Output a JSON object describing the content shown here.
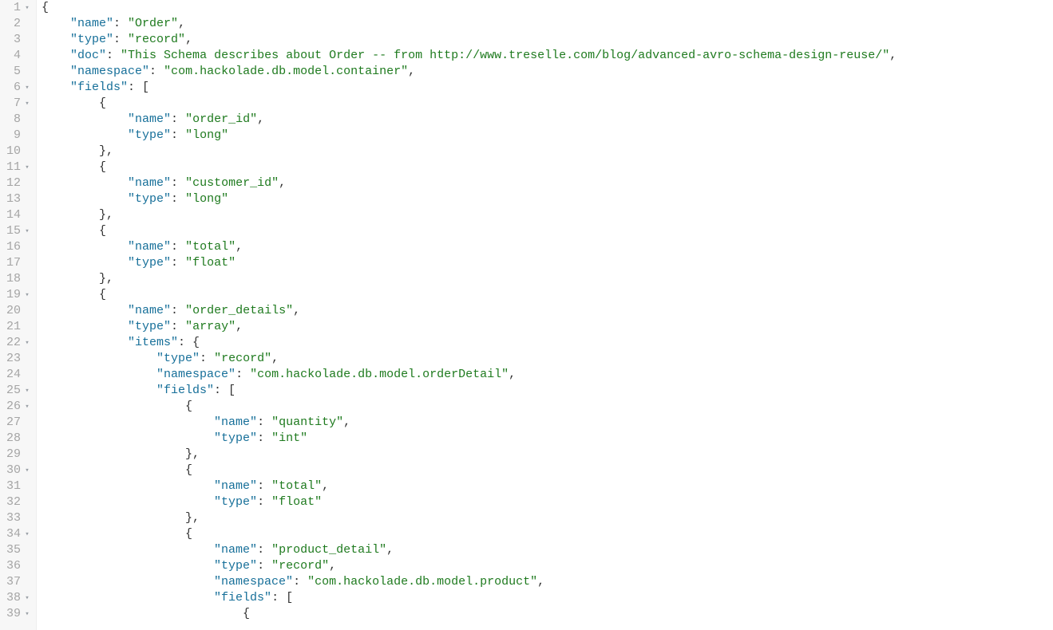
{
  "editor": {
    "line_count": 39,
    "fold_lines": [
      1,
      6,
      7,
      11,
      15,
      19,
      22,
      25,
      26,
      30,
      34,
      38,
      39
    ]
  },
  "code_lines": [
    {
      "indent": 0,
      "tokens": [
        {
          "t": "punct",
          "v": "{"
        }
      ]
    },
    {
      "indent": 4,
      "tokens": [
        {
          "t": "key",
          "v": "\"name\""
        },
        {
          "t": "punct",
          "v": ": "
        },
        {
          "t": "str",
          "v": "\"Order\""
        },
        {
          "t": "punct",
          "v": ","
        }
      ]
    },
    {
      "indent": 4,
      "tokens": [
        {
          "t": "key",
          "v": "\"type\""
        },
        {
          "t": "punct",
          "v": ": "
        },
        {
          "t": "str",
          "v": "\"record\""
        },
        {
          "t": "punct",
          "v": ","
        }
      ]
    },
    {
      "indent": 4,
      "tokens": [
        {
          "t": "key",
          "v": "\"doc\""
        },
        {
          "t": "punct",
          "v": ": "
        },
        {
          "t": "str",
          "v": "\"This Schema describes about Order -- from http://www.treselle.com/blog/advanced-avro-schema-design-reuse/\""
        },
        {
          "t": "punct",
          "v": ","
        }
      ]
    },
    {
      "indent": 4,
      "tokens": [
        {
          "t": "key",
          "v": "\"namespace\""
        },
        {
          "t": "punct",
          "v": ": "
        },
        {
          "t": "str",
          "v": "\"com.hackolade.db.model.container\""
        },
        {
          "t": "punct",
          "v": ","
        }
      ]
    },
    {
      "indent": 4,
      "tokens": [
        {
          "t": "key",
          "v": "\"fields\""
        },
        {
          "t": "punct",
          "v": ": ["
        }
      ]
    },
    {
      "indent": 8,
      "tokens": [
        {
          "t": "punct",
          "v": "{"
        }
      ]
    },
    {
      "indent": 12,
      "tokens": [
        {
          "t": "key",
          "v": "\"name\""
        },
        {
          "t": "punct",
          "v": ": "
        },
        {
          "t": "str",
          "v": "\"order_id\""
        },
        {
          "t": "punct",
          "v": ","
        }
      ]
    },
    {
      "indent": 12,
      "tokens": [
        {
          "t": "key",
          "v": "\"type\""
        },
        {
          "t": "punct",
          "v": ": "
        },
        {
          "t": "str",
          "v": "\"long\""
        }
      ]
    },
    {
      "indent": 8,
      "tokens": [
        {
          "t": "punct",
          "v": "},"
        }
      ]
    },
    {
      "indent": 8,
      "tokens": [
        {
          "t": "punct",
          "v": "{"
        }
      ]
    },
    {
      "indent": 12,
      "tokens": [
        {
          "t": "key",
          "v": "\"name\""
        },
        {
          "t": "punct",
          "v": ": "
        },
        {
          "t": "str",
          "v": "\"customer_id\""
        },
        {
          "t": "punct",
          "v": ","
        }
      ]
    },
    {
      "indent": 12,
      "tokens": [
        {
          "t": "key",
          "v": "\"type\""
        },
        {
          "t": "punct",
          "v": ": "
        },
        {
          "t": "str",
          "v": "\"long\""
        }
      ]
    },
    {
      "indent": 8,
      "tokens": [
        {
          "t": "punct",
          "v": "},"
        }
      ]
    },
    {
      "indent": 8,
      "tokens": [
        {
          "t": "punct",
          "v": "{"
        }
      ]
    },
    {
      "indent": 12,
      "tokens": [
        {
          "t": "key",
          "v": "\"name\""
        },
        {
          "t": "punct",
          "v": ": "
        },
        {
          "t": "str",
          "v": "\"total\""
        },
        {
          "t": "punct",
          "v": ","
        }
      ]
    },
    {
      "indent": 12,
      "tokens": [
        {
          "t": "key",
          "v": "\"type\""
        },
        {
          "t": "punct",
          "v": ": "
        },
        {
          "t": "str",
          "v": "\"float\""
        }
      ]
    },
    {
      "indent": 8,
      "tokens": [
        {
          "t": "punct",
          "v": "},"
        }
      ]
    },
    {
      "indent": 8,
      "tokens": [
        {
          "t": "punct",
          "v": "{"
        }
      ]
    },
    {
      "indent": 12,
      "tokens": [
        {
          "t": "key",
          "v": "\"name\""
        },
        {
          "t": "punct",
          "v": ": "
        },
        {
          "t": "str",
          "v": "\"order_details\""
        },
        {
          "t": "punct",
          "v": ","
        }
      ]
    },
    {
      "indent": 12,
      "tokens": [
        {
          "t": "key",
          "v": "\"type\""
        },
        {
          "t": "punct",
          "v": ": "
        },
        {
          "t": "str",
          "v": "\"array\""
        },
        {
          "t": "punct",
          "v": ","
        }
      ]
    },
    {
      "indent": 12,
      "tokens": [
        {
          "t": "key",
          "v": "\"items\""
        },
        {
          "t": "punct",
          "v": ": {"
        }
      ]
    },
    {
      "indent": 16,
      "tokens": [
        {
          "t": "key",
          "v": "\"type\""
        },
        {
          "t": "punct",
          "v": ": "
        },
        {
          "t": "str",
          "v": "\"record\""
        },
        {
          "t": "punct",
          "v": ","
        }
      ]
    },
    {
      "indent": 16,
      "tokens": [
        {
          "t": "key",
          "v": "\"namespace\""
        },
        {
          "t": "punct",
          "v": ": "
        },
        {
          "t": "str",
          "v": "\"com.hackolade.db.model.orderDetail\""
        },
        {
          "t": "punct",
          "v": ","
        }
      ]
    },
    {
      "indent": 16,
      "tokens": [
        {
          "t": "key",
          "v": "\"fields\""
        },
        {
          "t": "punct",
          "v": ": ["
        }
      ]
    },
    {
      "indent": 20,
      "tokens": [
        {
          "t": "punct",
          "v": "{"
        }
      ]
    },
    {
      "indent": 24,
      "tokens": [
        {
          "t": "key",
          "v": "\"name\""
        },
        {
          "t": "punct",
          "v": ": "
        },
        {
          "t": "str",
          "v": "\"quantity\""
        },
        {
          "t": "punct",
          "v": ","
        }
      ]
    },
    {
      "indent": 24,
      "tokens": [
        {
          "t": "key",
          "v": "\"type\""
        },
        {
          "t": "punct",
          "v": ": "
        },
        {
          "t": "str",
          "v": "\"int\""
        }
      ]
    },
    {
      "indent": 20,
      "tokens": [
        {
          "t": "punct",
          "v": "},"
        }
      ]
    },
    {
      "indent": 20,
      "tokens": [
        {
          "t": "punct",
          "v": "{"
        }
      ]
    },
    {
      "indent": 24,
      "tokens": [
        {
          "t": "key",
          "v": "\"name\""
        },
        {
          "t": "punct",
          "v": ": "
        },
        {
          "t": "str",
          "v": "\"total\""
        },
        {
          "t": "punct",
          "v": ","
        }
      ]
    },
    {
      "indent": 24,
      "tokens": [
        {
          "t": "key",
          "v": "\"type\""
        },
        {
          "t": "punct",
          "v": ": "
        },
        {
          "t": "str",
          "v": "\"float\""
        }
      ]
    },
    {
      "indent": 20,
      "tokens": [
        {
          "t": "punct",
          "v": "},"
        }
      ]
    },
    {
      "indent": 20,
      "tokens": [
        {
          "t": "punct",
          "v": "{"
        }
      ]
    },
    {
      "indent": 24,
      "tokens": [
        {
          "t": "key",
          "v": "\"name\""
        },
        {
          "t": "punct",
          "v": ": "
        },
        {
          "t": "str",
          "v": "\"product_detail\""
        },
        {
          "t": "punct",
          "v": ","
        }
      ]
    },
    {
      "indent": 24,
      "tokens": [
        {
          "t": "key",
          "v": "\"type\""
        },
        {
          "t": "punct",
          "v": ": "
        },
        {
          "t": "str",
          "v": "\"record\""
        },
        {
          "t": "punct",
          "v": ","
        }
      ]
    },
    {
      "indent": 24,
      "tokens": [
        {
          "t": "key",
          "v": "\"namespace\""
        },
        {
          "t": "punct",
          "v": ": "
        },
        {
          "t": "str",
          "v": "\"com.hackolade.db.model.product\""
        },
        {
          "t": "punct",
          "v": ","
        }
      ]
    },
    {
      "indent": 24,
      "tokens": [
        {
          "t": "key",
          "v": "\"fields\""
        },
        {
          "t": "punct",
          "v": ": ["
        }
      ]
    },
    {
      "indent": 28,
      "tokens": [
        {
          "t": "punct",
          "v": "{"
        }
      ]
    }
  ],
  "schema_content": {
    "name": "Order",
    "type": "record",
    "doc": "This Schema describes about Order -- from http://www.treselle.com/blog/advanced-avro-schema-design-reuse/",
    "namespace": "com.hackolade.db.model.container",
    "fields": [
      {
        "name": "order_id",
        "type": "long"
      },
      {
        "name": "customer_id",
        "type": "long"
      },
      {
        "name": "total",
        "type": "float"
      },
      {
        "name": "order_details",
        "type": "array",
        "items": {
          "type": "record",
          "namespace": "com.hackolade.db.model.orderDetail",
          "fields": [
            {
              "name": "quantity",
              "type": "int"
            },
            {
              "name": "total",
              "type": "float"
            },
            {
              "name": "product_detail",
              "type": "record",
              "namespace": "com.hackolade.db.model.product",
              "fields": []
            }
          ]
        }
      }
    ]
  }
}
